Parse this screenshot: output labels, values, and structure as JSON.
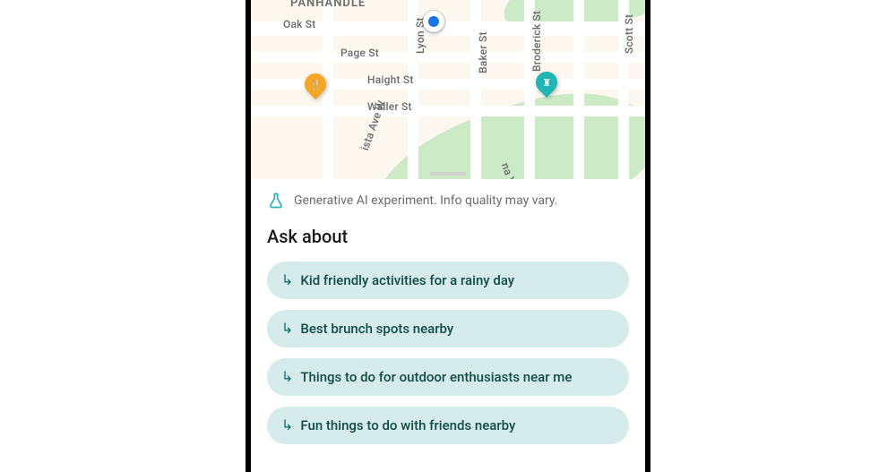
{
  "map": {
    "area_label": "PANHANDLE",
    "streets_h": [
      "Oak St",
      "Page St",
      "Haight St",
      "Waller St"
    ],
    "streets_v": [
      "Lyon St",
      "Baker St",
      "Broderick St",
      "Scott St"
    ],
    "streets_diag": [
      "ista Ave W",
      "na Vista Ave E"
    ],
    "pins": {
      "food_glyph": "🍴",
      "attraction_glyph": "♜"
    }
  },
  "ai_banner": {
    "text": "Generative AI experiment. Info quality may vary."
  },
  "ask": {
    "heading": "Ask about",
    "suggestions": [
      "Kid friendly activities for a rainy day",
      "Best brunch spots nearby",
      "Things to do for outdoor enthusiasts near me",
      "Fun things to do with friends nearby"
    ]
  },
  "colors": {
    "chip_bg": "#d5ecea",
    "chip_text": "#134b47",
    "accent": "#1fb6b3"
  }
}
